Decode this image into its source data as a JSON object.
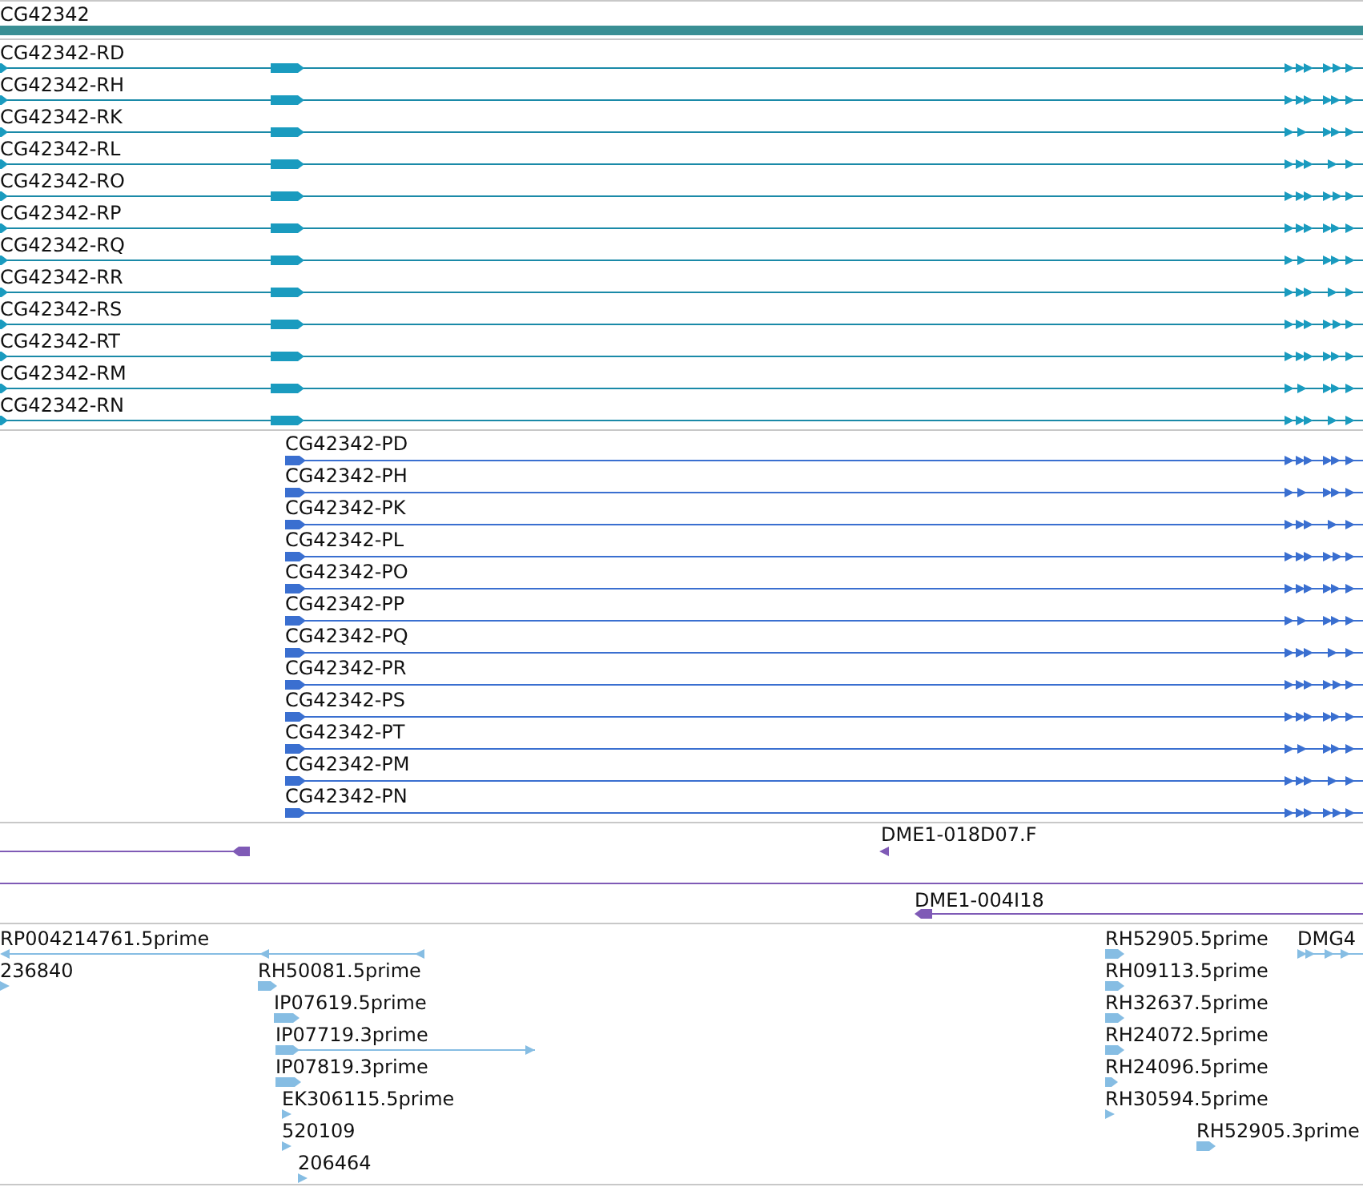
{
  "gene": {
    "label": "CG42342"
  },
  "transcripts": [
    "CG42342-RD",
    "CG42342-RH",
    "CG42342-RK",
    "CG42342-RL",
    "CG42342-RO",
    "CG42342-RP",
    "CG42342-RQ",
    "CG42342-RR",
    "CG42342-RS",
    "CG42342-RT",
    "CG42342-RM",
    "CG42342-RN"
  ],
  "proteins": [
    "CG42342-PD",
    "CG42342-PH",
    "CG42342-PK",
    "CG42342-PL",
    "CG42342-PO",
    "CG42342-PP",
    "CG42342-PQ",
    "CG42342-PR",
    "CG42342-PS",
    "CG42342-PT",
    "CG42342-PM",
    "CG42342-PN"
  ],
  "clones": [
    "DME1-018D07.F",
    "DME1-004I18"
  ],
  "ests": [
    "RP004214761.5prime",
    "RH52905.5prime",
    "DMG4",
    "236840",
    "RH50081.5prime",
    "RH09113.5prime",
    "IP07619.5prime",
    "RH32637.5prime",
    "IP07719.3prime",
    "RH24072.5prime",
    "IP07819.3prime",
    "RH24096.5prime",
    "EK306115.5prime",
    "RH30594.5prime",
    "520109",
    "RH52905.3prime",
    "206464"
  ]
}
